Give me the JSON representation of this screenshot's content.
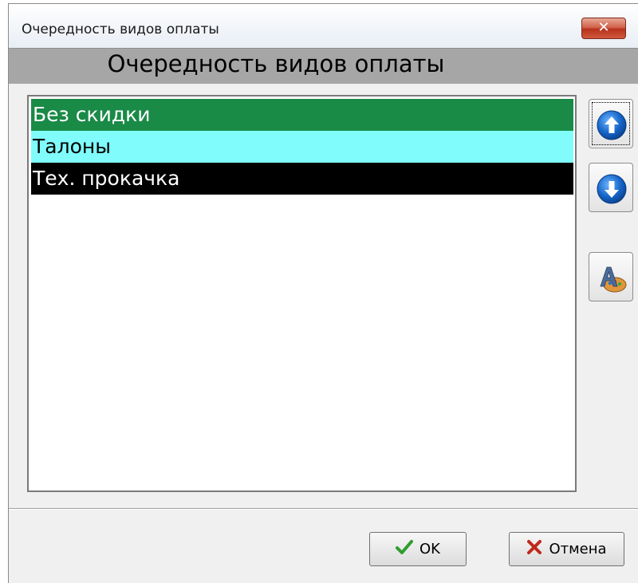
{
  "window": {
    "title": "Очередность видов оплаты",
    "close_label": "✕"
  },
  "header": {
    "title": "Очередность видов оплаты"
  },
  "payment_list": {
    "items": [
      {
        "label": "Без скидки",
        "bg": "#1a8a47",
        "fg": "#ffffff",
        "selected": true
      },
      {
        "label": "Талоны",
        "bg": "#80fcfc",
        "fg": "#000000",
        "selected": false
      },
      {
        "label": "Тех. прокачка",
        "bg": "#000000",
        "fg": "#ffffff",
        "selected": false
      }
    ]
  },
  "side_buttons": {
    "move_up_icon": "arrow-up-circle-icon",
    "move_down_icon": "arrow-down-circle-icon",
    "format_icon": "font-palette-icon"
  },
  "buttons": {
    "ok_label": "OK",
    "cancel_label": "Отмена"
  },
  "colors": {
    "icon_blue": "#1565c8",
    "ok_check": "#2e9e2e",
    "cancel_x": "#c0281a"
  }
}
